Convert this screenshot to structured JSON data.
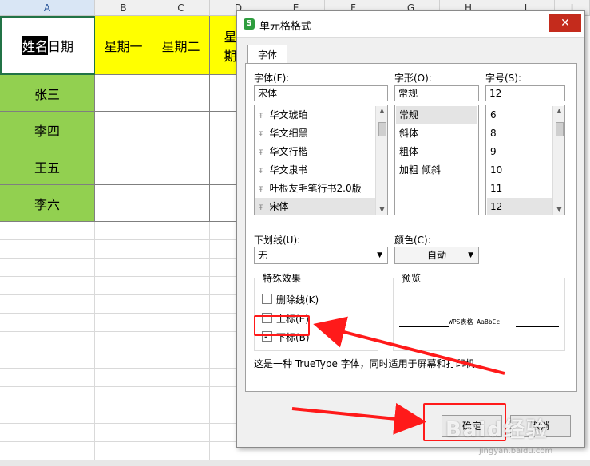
{
  "sheet": {
    "columns": [
      "A",
      "B",
      "C",
      "D",
      "E",
      "F",
      "G",
      "H",
      "I",
      "J"
    ],
    "a1_selected_text": "姓名",
    "a1_rest_text": "日期",
    "header_row": [
      "星期一",
      "星期二",
      "星期"
    ],
    "names": [
      "张三",
      "李四",
      "王五",
      "李六"
    ],
    "colors": {
      "header_fill": "#ffff00",
      "name_fill": "#92d050"
    }
  },
  "dialog": {
    "title": "单元格格式",
    "close_glyph": "✕",
    "tab_font": "字体",
    "font": {
      "label": "字体(F):",
      "value": "宋体",
      "items": [
        "华文琥珀",
        "华文细黑",
        "华文行楷",
        "华文隶书",
        "叶根友毛笔行书2.0版",
        "宋体"
      ]
    },
    "style": {
      "label": "字形(O):",
      "value": "常规",
      "items": [
        "常规",
        "斜体",
        "粗体",
        "加粗 倾斜"
      ]
    },
    "size": {
      "label": "字号(S):",
      "value": "12",
      "items": [
        "6",
        "8",
        "9",
        "10",
        "11",
        "12"
      ]
    },
    "underline": {
      "label": "下划线(U):",
      "value": "无"
    },
    "color": {
      "label": "颜色(C):",
      "value": "自动"
    },
    "effects": {
      "title": "特殊效果",
      "strikethrough": "删除线(K)",
      "superscript": "上标(E)",
      "subscript": "下标(B)",
      "subscript_checked": true
    },
    "preview": {
      "title": "预览",
      "sample_text": "WPS表格  AaBbCc"
    },
    "description": "这是一种 TrueType 字体，同时适用于屏幕和打印机。",
    "ok_label": "确定",
    "cancel_label": "取消"
  },
  "watermark": {
    "text": "Baid经验",
    "sub": "jingyan.baidu.com"
  },
  "annotation_color": "#ff1a1a"
}
